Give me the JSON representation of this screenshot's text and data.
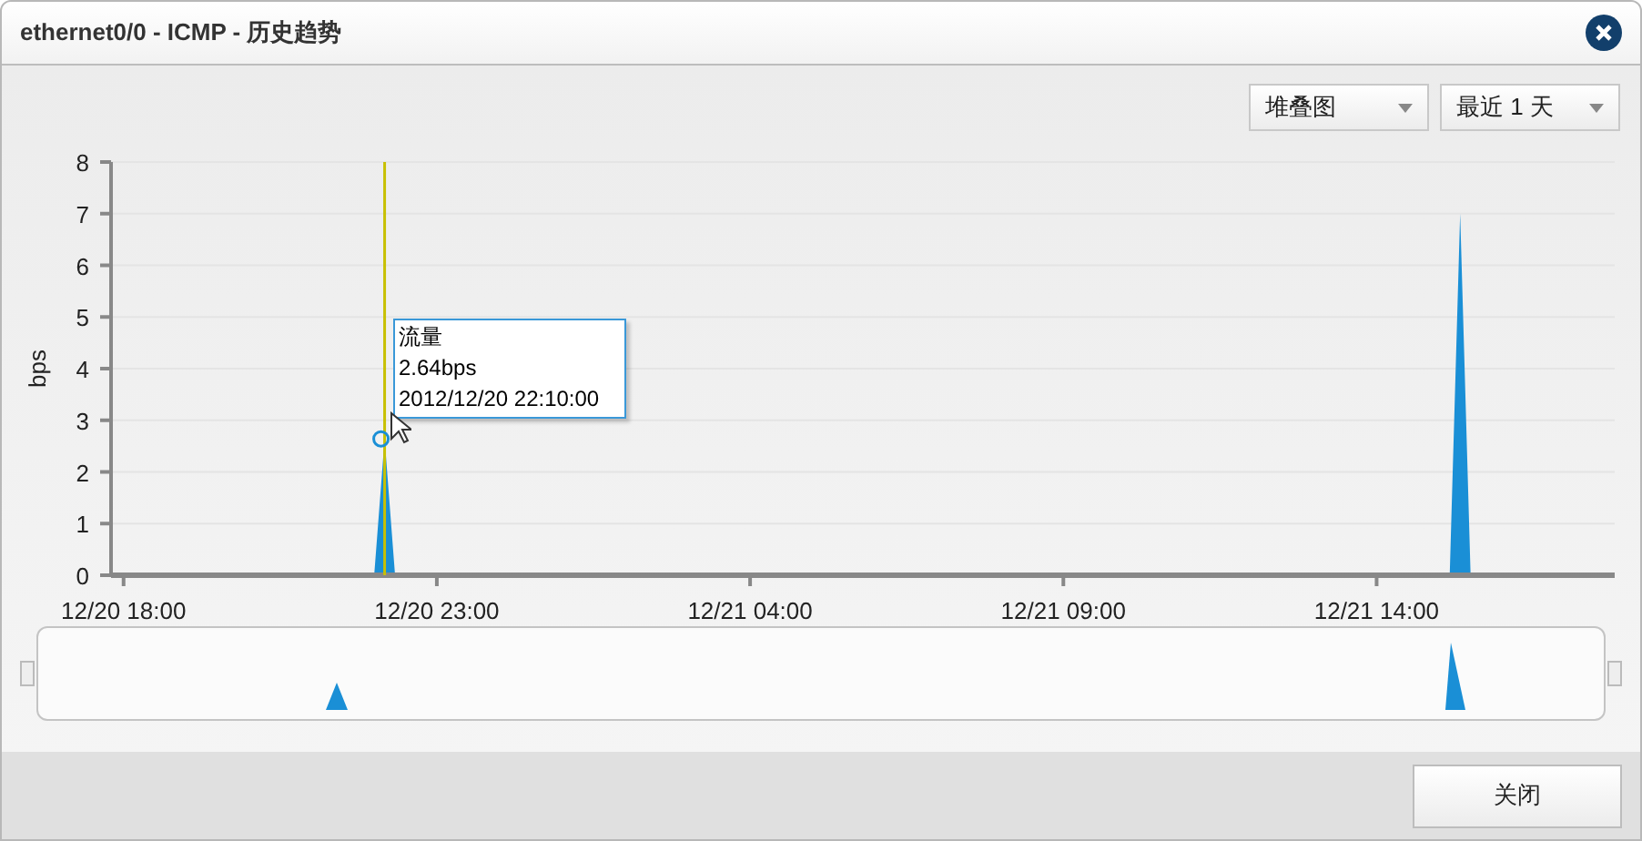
{
  "window": {
    "title": "ethernet0/0 - ICMP - 历史趋势"
  },
  "toolbar": {
    "chart_type": "堆叠图",
    "time_range": "最近 1 天"
  },
  "chart": {
    "chart_data": {
      "type": "area",
      "ylabel": "bps",
      "categories": [
        "12/20 18:00",
        null,
        null,
        null,
        null,
        null,
        null,
        null,
        null,
        null,
        null,
        null,
        null,
        null,
        null,
        null,
        null,
        null,
        null,
        null,
        null,
        null,
        null,
        null,
        null,
        null,
        null,
        null,
        null,
        null,
        "12/20 23:00",
        null,
        null,
        null,
        null,
        null,
        null,
        null,
        null,
        null,
        null,
        null,
        null,
        null,
        null,
        null,
        null,
        null,
        null,
        null,
        null,
        null,
        null,
        null,
        null,
        null,
        null,
        null,
        null,
        null,
        "12/21 04:00",
        null,
        null,
        null,
        null,
        null,
        null,
        null,
        null,
        null,
        null,
        null,
        null,
        null,
        null,
        null,
        null,
        null,
        null,
        null,
        null,
        null,
        null,
        null,
        null,
        null,
        null,
        null,
        null,
        null,
        "12/21 09:00",
        null,
        null,
        null,
        null,
        null,
        null,
        null,
        null,
        null,
        null,
        null,
        null,
        null,
        null,
        null,
        null,
        null,
        null,
        null,
        null,
        null,
        null,
        null,
        null,
        null,
        null,
        null,
        null,
        null,
        "12/21 14:00",
        null,
        null,
        null,
        null,
        null,
        null,
        null,
        null,
        null,
        null,
        null,
        null,
        null,
        null,
        null,
        null,
        null,
        null,
        null,
        null,
        null,
        null,
        null
      ],
      "series": [
        {
          "name": "流量",
          "color": "#1a8fd6",
          "values": [
            0,
            0,
            0,
            0,
            0,
            0,
            0,
            0,
            0,
            0,
            0,
            0,
            0,
            0,
            0,
            0,
            0,
            0,
            0,
            0,
            0,
            0,
            0,
            0,
            0,
            2.64,
            0,
            0,
            0,
            0,
            0,
            0,
            0,
            0,
            0,
            0,
            0,
            0,
            0,
            0,
            0,
            0,
            0,
            0,
            0,
            0,
            0,
            0,
            0,
            0,
            0,
            0,
            0,
            0,
            0,
            0,
            0,
            0,
            0,
            0,
            0,
            0,
            0,
            0,
            0,
            0,
            0,
            0,
            0,
            0,
            0,
            0,
            0,
            0,
            0,
            0,
            0,
            0,
            0,
            0,
            0,
            0,
            0,
            0,
            0,
            0,
            0,
            0,
            0,
            0,
            0,
            0,
            0,
            0,
            0,
            0,
            0,
            0,
            0,
            0,
            0,
            0,
            0,
            0,
            0,
            0,
            0,
            0,
            0,
            0,
            0,
            0,
            0,
            0,
            0,
            0,
            0,
            0,
            0,
            0,
            0,
            0,
            0,
            0,
            0,
            0,
            0,
            0,
            7,
            0,
            0,
            0,
            0,
            0,
            0,
            0,
            0,
            0,
            0,
            0,
            0,
            0,
            0,
            0
          ]
        }
      ],
      "ylim": [
        0,
        8
      ],
      "yticks": [
        0,
        1,
        2,
        3,
        4,
        5,
        6,
        7,
        8
      ],
      "grid": true
    },
    "tooltip": {
      "value": "2.64bps",
      "time": "2012/12/20 22:10:00"
    }
  },
  "footer": {
    "close_button": "关闭"
  }
}
